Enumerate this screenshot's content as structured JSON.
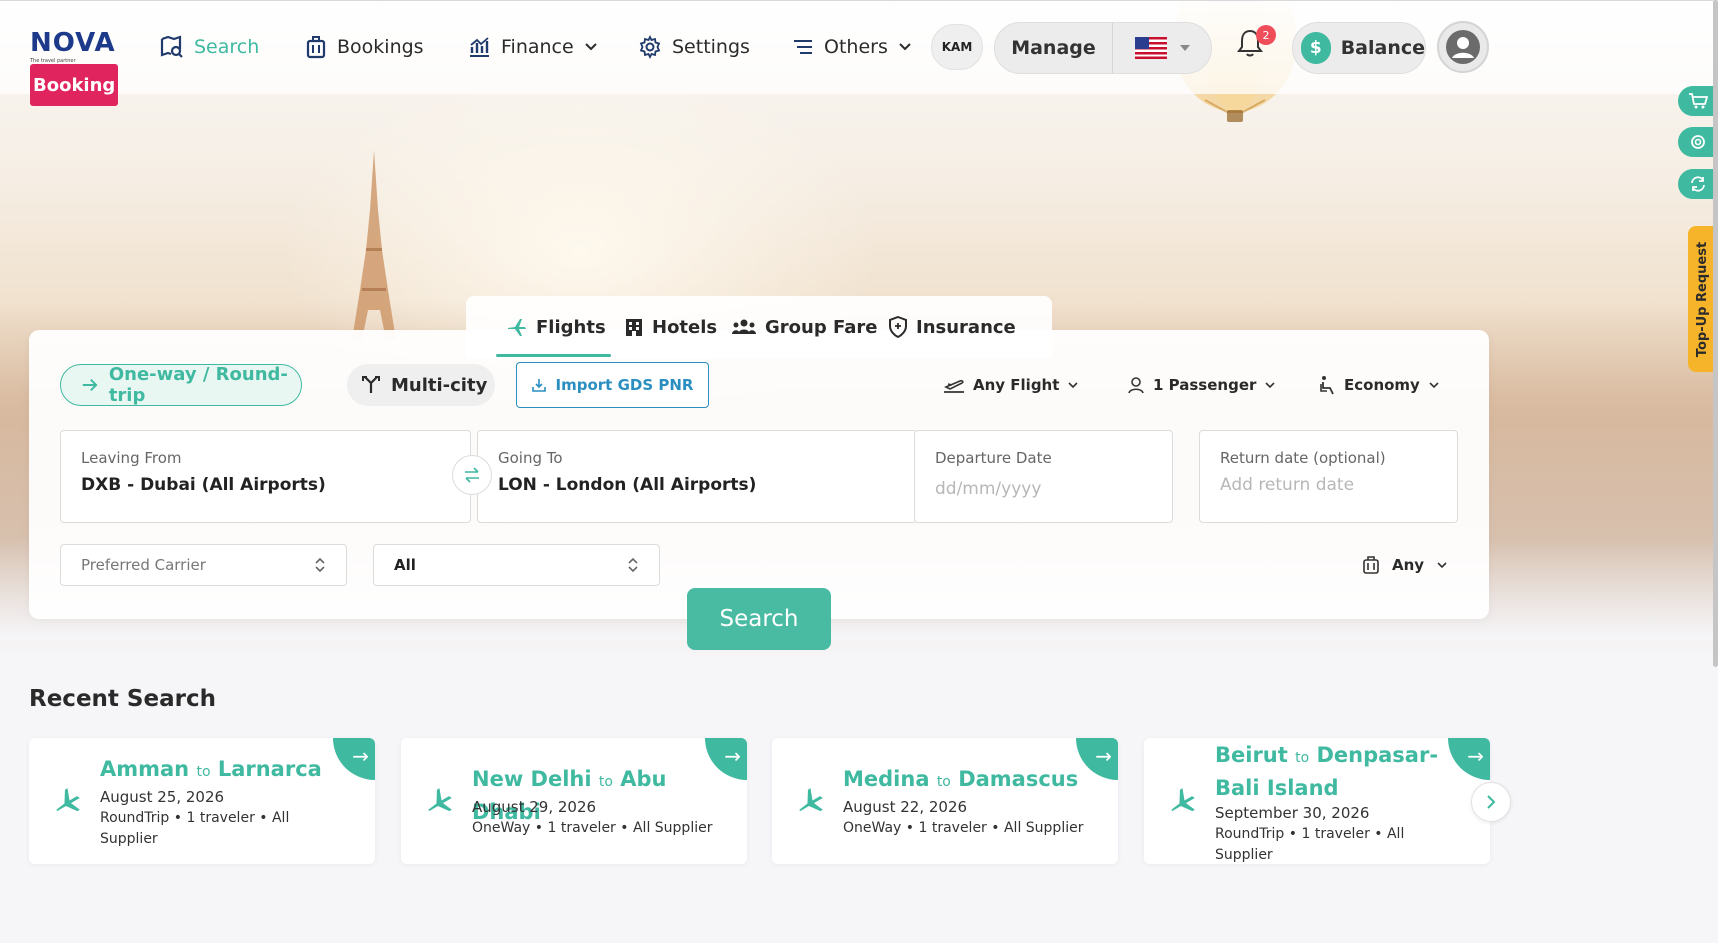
{
  "brand": {
    "logo_text": "NOVA",
    "tagline": "The travel partner",
    "tagline_pill": "Booking"
  },
  "nav": {
    "search": "Search",
    "bookings": "Bookings",
    "finance": "Finance",
    "settings": "Settings",
    "others": "Others",
    "kam": "KAM",
    "manage": "Manage",
    "notifications_count": "2",
    "balance": "Balance",
    "balance_symbol": "$"
  },
  "side": {
    "topup": "Top-Up Request"
  },
  "tabs": [
    {
      "label": "Flights",
      "icon": "plane-icon",
      "active": true
    },
    {
      "label": "Hotels",
      "icon": "building-icon"
    },
    {
      "label": "Group Fare",
      "icon": "group-icon"
    },
    {
      "label": "Insurance",
      "icon": "shield-icon"
    }
  ],
  "search": {
    "trip_oneway": "One-way / Round-trip",
    "trip_multi": "Multi-city",
    "import_gds": "Import GDS PNR",
    "flight_type": "Any Flight",
    "passengers": "1 Passenger",
    "cabin": "Economy",
    "from_label": "Leaving From",
    "from_value": "DXB - Dubai (All Airports)",
    "to_label": "Going To",
    "to_value": "LON - London (All Airports)",
    "depart_label": "Departure Date",
    "depart_placeholder": "dd/mm/yyyy",
    "return_label": "Return date (optional)",
    "return_placeholder": "Add return date",
    "carrier_placeholder": "Preferred Carrier",
    "supplier_value": "All",
    "baggage_value": "Any",
    "submit": "Search"
  },
  "recent": {
    "title": "Recent Search",
    "to_word": "to",
    "items": [
      {
        "from": "Amman",
        "to": "Larnarca",
        "date": "August 25, 2026",
        "meta": "RoundTrip  •  1 traveler  •  All Supplier"
      },
      {
        "from": "New Delhi",
        "to": "Abu Dhabi",
        "date": "August 29, 2026",
        "meta": "OneWay  •  1 traveler  •  All Supplier"
      },
      {
        "from": "Medina",
        "to": "Damascus",
        "date": "August 22, 2026",
        "meta": "OneWay  •  1 traveler  •  All Supplier"
      },
      {
        "from": "Beirut",
        "to": "Denpasar-Bali Island",
        "date": "September 30, 2026",
        "meta": "RoundTrip  •  1 traveler  •  All Supplier"
      }
    ]
  },
  "colors": {
    "accent": "#3fb9a0",
    "link": "#2a8fc0",
    "badge": "#ef4d5a",
    "topup": "#f6b42a"
  }
}
